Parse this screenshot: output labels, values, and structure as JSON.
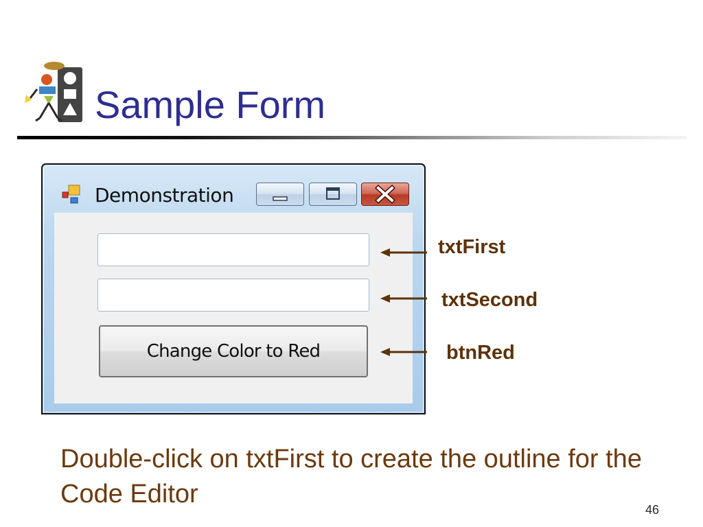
{
  "slide": {
    "title": "Sample Form",
    "description": "Double-click on txtFirst to create the outline for the Code Editor",
    "page_number": "46"
  },
  "window": {
    "title": "Demonstration",
    "textbox_first_value": "",
    "textbox_second_value": "",
    "button_label": "Change Color to Red"
  },
  "annotations": {
    "first": "txtFirst",
    "second": "txtSecond",
    "button": "btnRed"
  },
  "colors": {
    "title": "#2E2E8F",
    "annotation": "#5c3209",
    "description": "#6B3A0E",
    "arrow": "#5c3209"
  }
}
